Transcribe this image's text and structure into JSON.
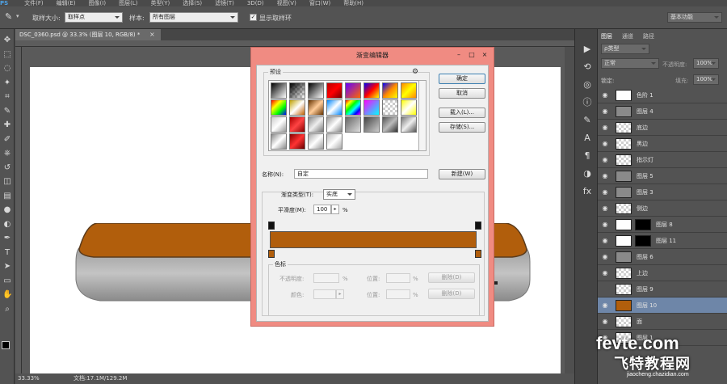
{
  "menubar": [
    "PS",
    "文件(F)",
    "编辑(E)",
    "图像(I)",
    "图层(L)",
    "类型(Y)",
    "选择(S)",
    "滤镜(T)",
    "3D(D)",
    "视图(V)",
    "窗口(W)",
    "帮助(H)"
  ],
  "optionsbar": {
    "sample_size_label": "取样大小:",
    "sample_size_value": "取样点",
    "sample_label": "样本:",
    "sample_value": "所有图层",
    "show_ring_label": "显示取样环",
    "workspace": "基本功能"
  },
  "document": {
    "tab_title": "DSC_0360.psd @ 33.3% (图层 10, RGB/8) *",
    "zoom": "33.33%",
    "doc_info": "文档:17.1M/129.2M"
  },
  "layers_panel": {
    "tabs": [
      "图层",
      "通道",
      "路径"
    ],
    "filter": "ρ类型",
    "blend_mode": "正常",
    "opacity_label": "不透明度:",
    "opacity_value": "100%",
    "lock_label": "锁定:",
    "fill_label": "填充:",
    "fill_value": "100%",
    "items": [
      {
        "name": "色阶 1",
        "thumb": "white"
      },
      {
        "name": "图层 4",
        "thumb": "gray"
      },
      {
        "name": "底边",
        "thumb": "checker"
      },
      {
        "name": "黑边",
        "thumb": "checker"
      },
      {
        "name": "指示灯",
        "thumb": "checker"
      },
      {
        "name": "图层 5",
        "thumb": "gray"
      },
      {
        "name": "图层 3",
        "thumb": "gray"
      },
      {
        "name": "侧边",
        "thumb": "checker"
      },
      {
        "name": "图层 8",
        "thumb": "white"
      },
      {
        "name": "图层 11",
        "thumb": "white"
      },
      {
        "name": "图层 6",
        "thumb": "gray"
      },
      {
        "name": "上边",
        "thumb": "checker"
      },
      {
        "name": "图层 9",
        "thumb": "checker"
      },
      {
        "name": "图层 10",
        "thumb": "orange"
      },
      {
        "name": "面",
        "thumb": "checker"
      },
      {
        "name": "图层 1",
        "thumb": "checker"
      }
    ]
  },
  "dialog": {
    "title": "渐变编辑器",
    "presets_label": "预设",
    "ok": "确定",
    "cancel": "取消",
    "load": "载入(L)...",
    "save": "存储(S)...",
    "name_label": "名称(N):",
    "name_value": "自定",
    "new_button": "新建(W)",
    "gradient_type_label": "渐变类型(T):",
    "gradient_type_value": "实底",
    "smoothness_label": "平滑度(M):",
    "smoothness_value": "100",
    "smoothness_unit": "%",
    "stops_label": "色标",
    "opacity_label": "不透明度:",
    "color_label": "颜色:",
    "position_label": "位置:",
    "percent": "%",
    "delete_label": "删除(D)",
    "gradient_color": "#b15e0c"
  },
  "watermark": {
    "line1": "fevte.com",
    "line2": "飞特教程网",
    "line3": "jiaocheng.chazidian.com"
  }
}
